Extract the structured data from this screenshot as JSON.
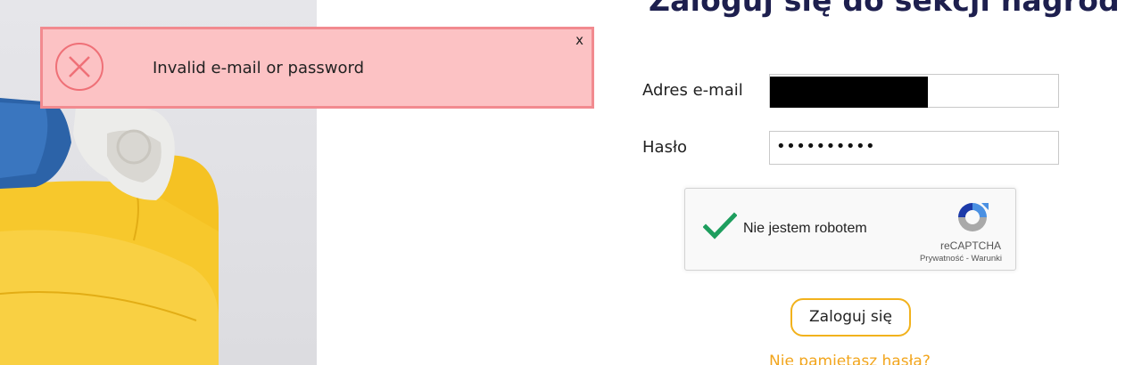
{
  "heading": "Zaloguj się do sekcji nagród",
  "toast": {
    "message": "Invalid e-mail or password",
    "close_label": "x",
    "icon": "error-x-circle-icon",
    "colors": {
      "background": "#fcc2c4",
      "border": "#f28a8f"
    }
  },
  "form": {
    "email_label": "Adres e-mail",
    "password_label": "Hasło",
    "password_value": "••••••••••"
  },
  "captcha": {
    "label": "Nie jestem robotem",
    "brand": "reCAPTCHA",
    "links": "Prywatność - Warunki",
    "checked": true
  },
  "login_button": "Zaloguj się",
  "forgot_link": "Nie pamiętasz hasła?",
  "colors": {
    "accent": "#f2b21c",
    "heading": "#1d1f4e",
    "link": "#f2a51c"
  }
}
